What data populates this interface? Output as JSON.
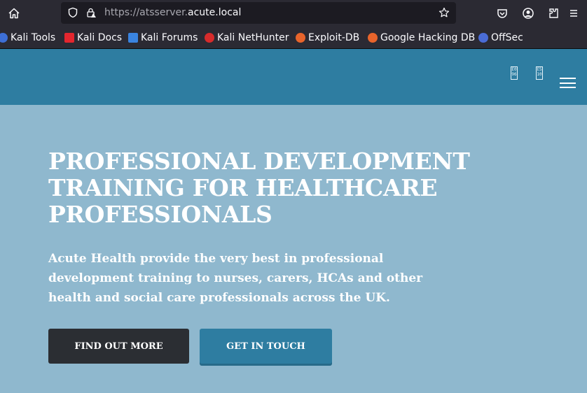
{
  "browser": {
    "url_prefix": "https://atsserver.",
    "url_domain": "acute.local",
    "bookmarks": [
      {
        "label": "Kali Tools",
        "color": "#3d6fd6"
      },
      {
        "label": "Kali Docs",
        "color": "#e3262e"
      },
      {
        "label": "Kali Forums",
        "color": "#3a84e0"
      },
      {
        "label": "Kali NetHunter",
        "color": "#d62b2b"
      },
      {
        "label": "Exploit-DB",
        "color": "#e8642b"
      },
      {
        "label": "Google Hacking DB",
        "color": "#e8642b"
      },
      {
        "label": "OffSec",
        "color": "#4a6cd6"
      }
    ]
  },
  "header": {
    "glyph1": "E0 96",
    "glyph2": "E5 10"
  },
  "hero": {
    "title": "PROFESSIONAL DEVELOPMENT TRAINING FOR HEALTHCARE PROFESSIONALS",
    "subtitle": "Acute Health provide the very best in professional development training to nurses, carers, HCAs and other health and social care professionals across the UK.",
    "primary_button": "FIND OUT MORE",
    "secondary_button": "GET IN TOUCH"
  },
  "colors": {
    "header": "#2e7da1",
    "hero_bg": "#8fb8ce",
    "dark_button": "#2b2e33"
  }
}
